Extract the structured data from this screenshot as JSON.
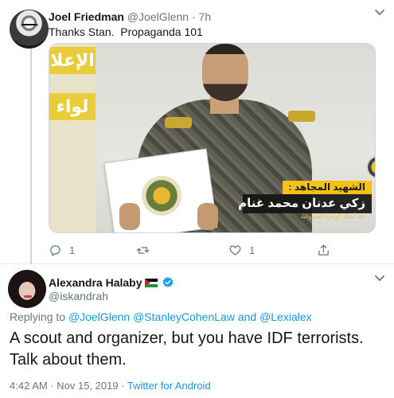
{
  "tweet1": {
    "author_name": "Joel Friedman",
    "author_handle": "@JoelGlenn",
    "age": "7h",
    "text": "Thanks Stan.  Propaganda 101",
    "media": {
      "banner_text_1": "الإعلا",
      "banner_text_2": "لواء",
      "caption_top": "الشهيد المجاهد :",
      "caption_main": "زكي عدنان محمد غنام",
      "caption_sub": "أحد أبطال الوحدة الصاروخية"
    },
    "actions": {
      "reply_count": "1",
      "retweet_count": "",
      "like_count": "1"
    }
  },
  "tweet2": {
    "author_name": "Alexandra Halaby",
    "author_handle": "@iskandrah",
    "replying_label": "Replying to",
    "reply_targets": [
      "@JoelGlenn",
      "@StanleyCohenLaw",
      "and",
      "@Lexialex"
    ],
    "text": "A scout and organizer, but you have IDF terrorists. Talk about them.",
    "timestamp": "4:42 AM · Nov 15, 2019 · ",
    "source": "Twitter for Android"
  },
  "colors": {
    "link": "#1b95e0",
    "secondary_text": "#657786",
    "verified": "#1da1f2",
    "divider": "#e6ecf0"
  },
  "icons": [
    "reply-icon",
    "retweet-icon",
    "like-icon",
    "share-icon",
    "verified-icon",
    "chevron-down-icon",
    "palestine-flag-icon"
  ]
}
